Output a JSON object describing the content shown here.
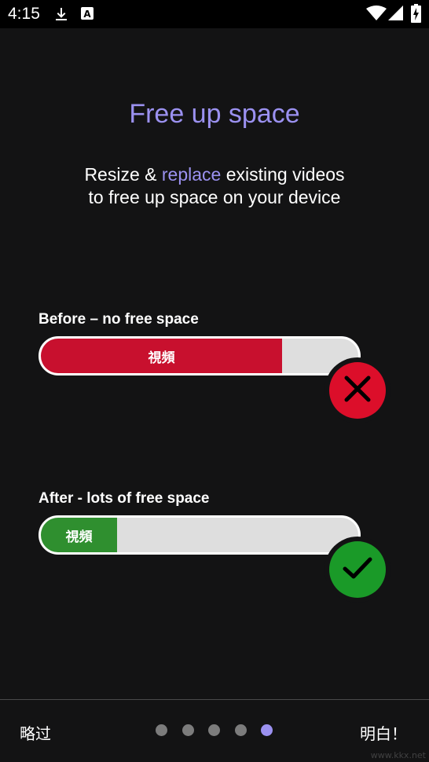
{
  "status_bar": {
    "time": "4:15",
    "left_icons": [
      "download-icon",
      "a-keyboard-icon"
    ],
    "right_icons": [
      "wifi-icon",
      "signal-icon",
      "battery-charging-icon"
    ]
  },
  "onboarding": {
    "title": "Free up space",
    "subtitle_part1": "Resize & ",
    "subtitle_accent": "replace",
    "subtitle_part2": " existing videos",
    "subtitle_line2": "to free up space on your device",
    "accent_color": "#9b91f0"
  },
  "before": {
    "label": "Before – no free space",
    "fill_label": "視頻",
    "fill_fraction": 0.76,
    "fill_color": "#c8102e",
    "status_icon": "close-x-icon",
    "status_color": "#dc0e2a"
  },
  "after": {
    "label": "After - lots of free space",
    "fill_label": "視頻",
    "fill_fraction": 0.24,
    "fill_color": "#2f8f2f",
    "status_icon": "checkmark-icon",
    "status_color": "#1a9a28"
  },
  "footer": {
    "skip_label": "略过",
    "ok_label": "明白！",
    "page_count": 5,
    "current_page": 5,
    "dot_color": "#7c7c7c",
    "dot_active_color": "#9b91f0"
  },
  "watermark": "www.kkx.net"
}
